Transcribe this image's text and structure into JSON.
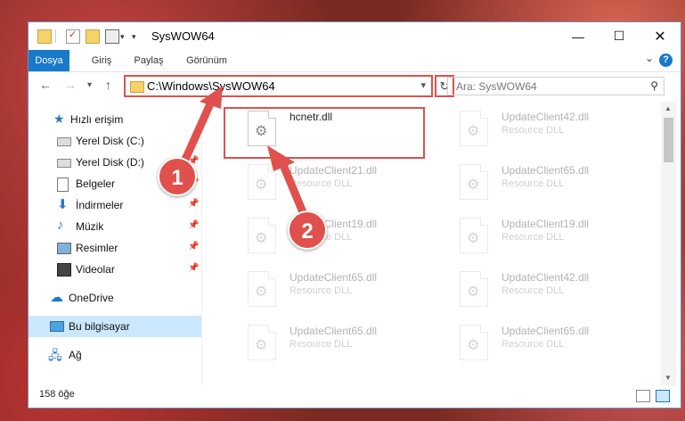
{
  "window": {
    "title": "SysWOW64"
  },
  "ribbon": {
    "tabs": [
      "Dosya",
      "Giriş",
      "Paylaş",
      "Görünüm"
    ]
  },
  "address": {
    "path": "C:\\Windows\\SysWOW64"
  },
  "search": {
    "placeholder": "Ara: SysWOW64"
  },
  "sidebar": {
    "items": [
      {
        "label": "Hızlı erişim",
        "icon": "star-icon"
      },
      {
        "label": "Yerel Disk (C:)",
        "icon": "drive-icon"
      },
      {
        "label": "Yerel Disk (D:)",
        "icon": "drive-icon"
      },
      {
        "label": "Belgeler",
        "icon": "documents-icon"
      },
      {
        "label": "İndirmeler",
        "icon": "download-icon"
      },
      {
        "label": "Müzik",
        "icon": "music-icon"
      },
      {
        "label": "Resimler",
        "icon": "pictures-icon"
      },
      {
        "label": "Videolar",
        "icon": "videos-icon"
      },
      {
        "label": "OneDrive",
        "icon": "cloud-icon"
      },
      {
        "label": "Bu bilgisayar",
        "icon": "computer-icon"
      },
      {
        "label": "Ağ",
        "icon": "network-icon"
      }
    ]
  },
  "files": [
    {
      "name": "hcnetr.dll",
      "desc": ""
    },
    {
      "name": "UpdateClient42.dll",
      "desc": "Resource DLL"
    },
    {
      "name": "UpdateClient21.dll",
      "desc": "Resource DLL"
    },
    {
      "name": "UpdateClient65.dll",
      "desc": "Resource DLL"
    },
    {
      "name": "UpdateClient19.dll",
      "desc": "Resource DLL"
    },
    {
      "name": "UpdateClient19.dll",
      "desc": "Resource DLL"
    },
    {
      "name": "UpdateClient65.dll",
      "desc": "Resource DLL"
    },
    {
      "name": "UpdateClient42.dll",
      "desc": "Resource DLL"
    },
    {
      "name": "UpdateClient65.dll",
      "desc": "Resource DLL"
    },
    {
      "name": "UpdateClient65.dll",
      "desc": "Resource DLL"
    }
  ],
  "status": {
    "count": "158 öğe"
  },
  "annotations": {
    "step1": "1",
    "step2": "2"
  },
  "colors": {
    "accent": "#1979ca",
    "highlight": "#d9534f",
    "selected": "#cce8ff"
  }
}
